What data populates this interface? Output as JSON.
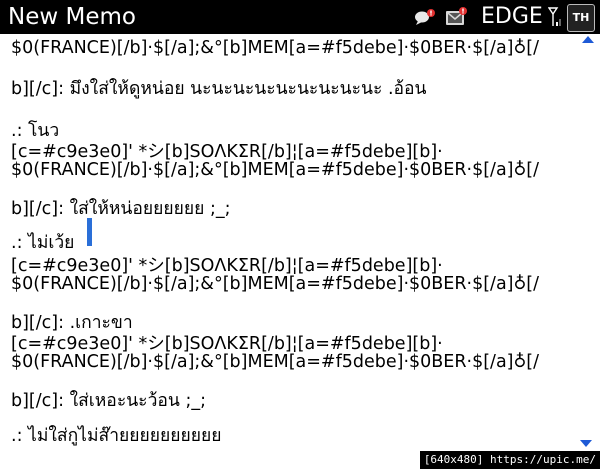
{
  "header": {
    "title": "New Memo",
    "network": "EDGE",
    "input_language": "TH",
    "icons": [
      "chat-notification-icon",
      "message-notification-icon",
      "signal-icon"
    ]
  },
  "memo": {
    "lines": [
      "$0(FRANCE)[/b]·$[/a];&°[b]MEM[a=#f5debe]·$0BER·$[/a]♁[/",
      "b][/c]: มึงใส่ให้ดูหน่อย นะนะนะนะนะนะนะนะนะ .อ้อน",
      ".: โนว",
      "[c=#c9e3e0]'              *シ[b]SOΛKΣR[/b]¦[a=#f5debe][b]·",
      "$0(FRANCE)[/b]·$[/a];&°[b]MEM[a=#f5debe]·$0BER·$[/a]♁[/",
      "b][/c]: ใส่ให้หน่อยยยยยย ;_;",
      ".: ไม่เว้ย",
      "[c=#c9e3e0]'              *シ[b]SOΛKΣR[/b]¦[a=#f5debe][b]·",
      "$0(FRANCE)[/b]·$[/a];&°[b]MEM[a=#f5debe]·$0BER·$[/a]♁[/",
      "b][/c]: .เกาะขา",
      "[c=#c9e3e0]'              *シ[b]SOΛKΣR[/b]¦[a=#f5debe][b]·",
      "$0(FRANCE)[/b]·$[/a];&°[b]MEM[a=#f5debe]·$0BER·$[/a]♁[/",
      "b][/c]: ใส่เหอะนะว้อน ;_;",
      ".: ไม่ใส่กูไม่ส๊ายยยยยยยยยย"
    ]
  },
  "watermark": "[640x480] https://upic.me/"
}
